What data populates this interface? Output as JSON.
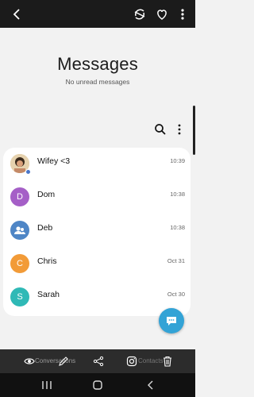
{
  "header": {
    "title": "Messages",
    "subtitle": "No unread messages"
  },
  "conversations": [
    {
      "name": "Wifey <3",
      "time": "10:39",
      "avatar_type": "photo",
      "avatar_color": "#d9c29c"
    },
    {
      "name": "Dom",
      "time": "10:38",
      "avatar_letter": "D",
      "avatar_color": "#a55fc7"
    },
    {
      "name": "Deb",
      "time": "10:38",
      "avatar_type": "group",
      "avatar_color": "#4f86c6"
    },
    {
      "name": "Chris",
      "time": "Oct 31",
      "avatar_letter": "C",
      "avatar_color": "#f29b38"
    },
    {
      "name": "Sarah",
      "time": "Oct 30",
      "avatar_letter": "S",
      "avatar_color": "#2fb9b6"
    }
  ],
  "toolbar": {
    "left_label": "Conversations",
    "right_label": "Contacts"
  },
  "colors": {
    "topbar": "#1b1b1b",
    "fab": "#33a3d6",
    "toolbar": "#2c2c2c",
    "navbar": "#111111"
  }
}
